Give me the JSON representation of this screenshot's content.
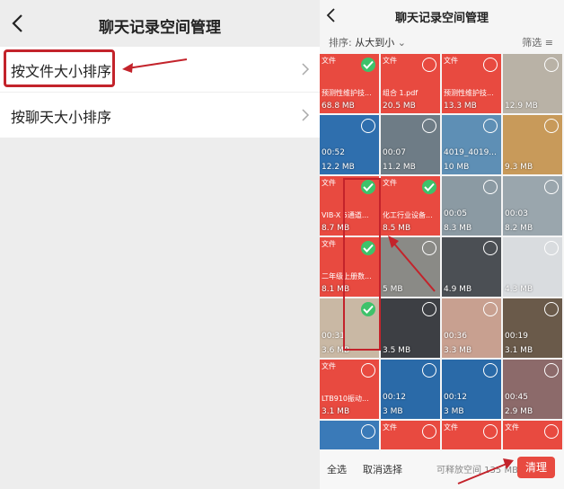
{
  "left": {
    "title": "聊天记录空间管理",
    "items": [
      {
        "label": "按文件大小排序"
      },
      {
        "label": "按聊天大小排序"
      }
    ]
  },
  "right": {
    "title": "聊天记录空间管理",
    "sort_label": "排序:",
    "sort_value": "从大到小",
    "filter_label": "筛选",
    "select_all": "全选",
    "cancel_select": "取消选择",
    "free_space": "可释放空间 135 MB",
    "clean_button": "清理",
    "tiles": [
      {
        "kind": "文件",
        "name": "预测性维护技...",
        "size": "68.8 MB",
        "checked": true,
        "bg": "#e84a40"
      },
      {
        "kind": "文件",
        "name": "组合 1.pdf",
        "size": "20.5 MB",
        "checked": false,
        "bg": "#e84a40"
      },
      {
        "kind": "文件",
        "name": "预测性维护技...",
        "size": "13.3 MB",
        "checked": false,
        "bg": "#e84a40"
      },
      {
        "kind": "",
        "name": "",
        "size": "12.9 MB",
        "checked": false,
        "bg": "#b9b2a6"
      },
      {
        "kind": "",
        "dur": "00:52",
        "size": "12.2 MB",
        "checked": false,
        "bg": "#2f6fae"
      },
      {
        "kind": "",
        "dur": "00:07",
        "size": "11.2 MB",
        "checked": false,
        "bg": "#6e7c86"
      },
      {
        "kind": "",
        "dur": "4019_4019...",
        "size": "10 MB",
        "checked": false,
        "bg": "#5e8fb5"
      },
      {
        "kind": "",
        "name": "",
        "size": "9.3 MB",
        "checked": false,
        "bg": "#c89a5a"
      },
      {
        "kind": "文件",
        "name": "VIB-X 5通道...",
        "size": "8.7 MB",
        "checked": true,
        "bg": "#e84a40"
      },
      {
        "kind": "文件",
        "name": "化工行业设备...",
        "size": "8.5 MB",
        "checked": true,
        "bg": "#e84a40"
      },
      {
        "kind": "",
        "dur": "00:05",
        "size": "8.3 MB",
        "checked": false,
        "bg": "#8b9aa3"
      },
      {
        "kind": "",
        "dur": "00:03",
        "size": "8.2 MB",
        "checked": false,
        "bg": "#9aa6ad"
      },
      {
        "kind": "文件",
        "name": "二年级上册数...",
        "size": "8.1 MB",
        "checked": true,
        "bg": "#e84a40"
      },
      {
        "kind": "",
        "name": "",
        "size": "5 MB",
        "checked": false,
        "bg": "#8a8a86"
      },
      {
        "kind": "",
        "name": "",
        "size": "4.9 MB",
        "checked": false,
        "bg": "#4b4f54"
      },
      {
        "kind": "",
        "name": "",
        "size": "4.3 MB",
        "checked": false,
        "bg": "#d9dcdf"
      },
      {
        "kind": "",
        "dur": "00:31",
        "size": "3.6 MB",
        "checked": true,
        "bg": "#c9b8a4"
      },
      {
        "kind": "",
        "name": "",
        "size": "3.5 MB",
        "checked": false,
        "bg": "#3d3f44"
      },
      {
        "kind": "",
        "dur": "00:36",
        "size": "3.3 MB",
        "checked": false,
        "bg": "#c8a090"
      },
      {
        "kind": "",
        "dur": "00:19",
        "size": "3.1 MB",
        "checked": false,
        "bg": "#6a5a4a"
      },
      {
        "kind": "文件",
        "name": "LTB910振动...",
        "size": "3.1 MB",
        "checked": false,
        "bg": "#e84a40"
      },
      {
        "kind": "",
        "dur": "00:12",
        "size": "3 MB",
        "checked": false,
        "bg": "#2a6aa8"
      },
      {
        "kind": "",
        "dur": "00:12",
        "size": "3 MB",
        "checked": false,
        "bg": "#2a6aa8"
      },
      {
        "kind": "",
        "dur": "00:45",
        "size": "2.9 MB",
        "checked": false,
        "bg": "#8c6a6a"
      },
      {
        "kind": "",
        "name": "",
        "size": "",
        "checked": false,
        "bg": "#3a7ab8"
      },
      {
        "kind": "文件",
        "name": "",
        "size": "",
        "checked": false,
        "bg": "#e84a40"
      },
      {
        "kind": "文件",
        "name": "",
        "size": "",
        "checked": false,
        "bg": "#e84a40"
      },
      {
        "kind": "文件",
        "name": "",
        "size": "",
        "checked": false,
        "bg": "#e84a40"
      }
    ]
  }
}
